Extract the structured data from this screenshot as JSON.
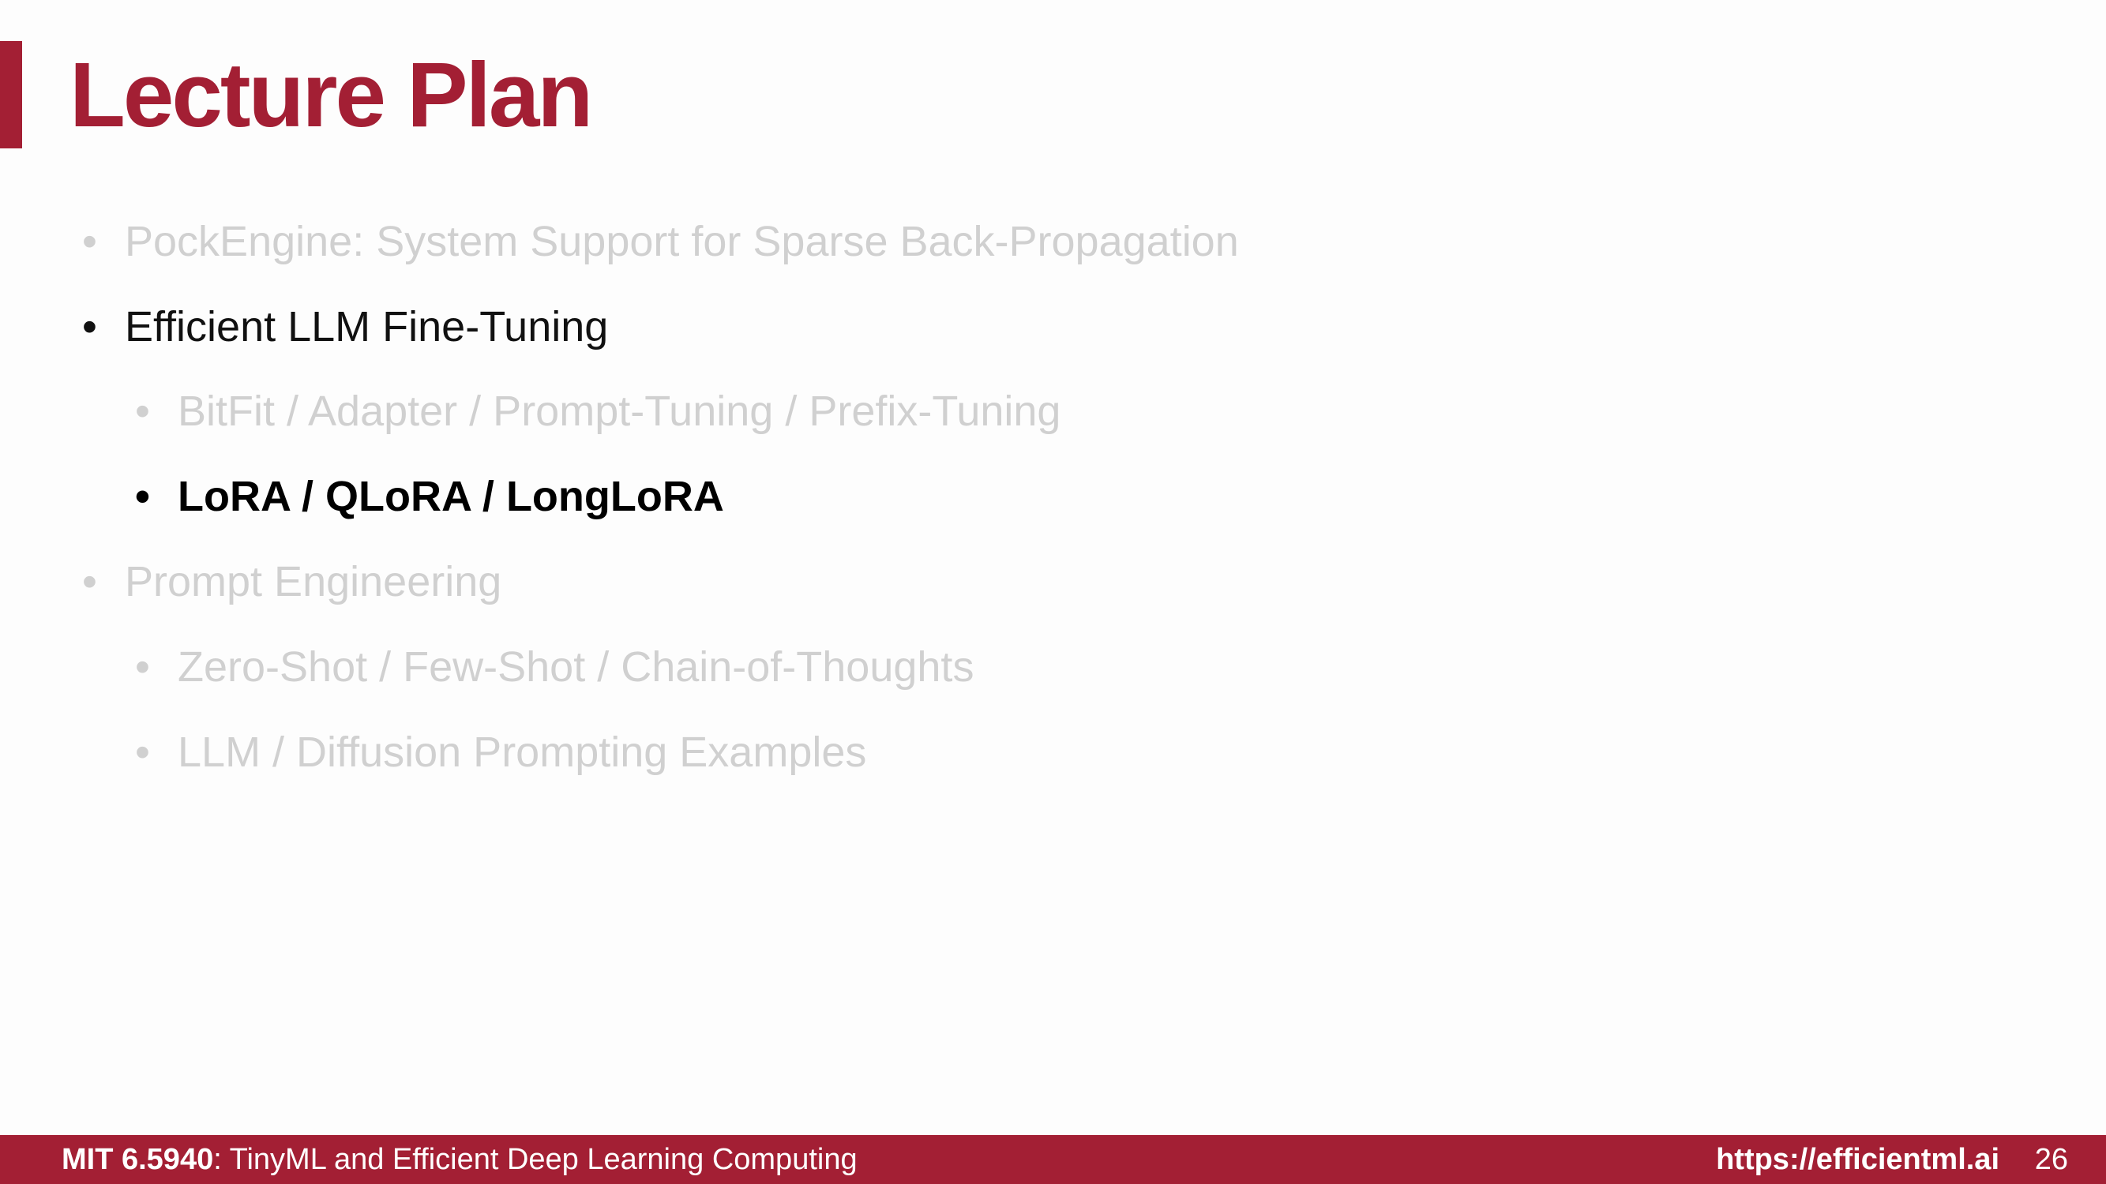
{
  "slide": {
    "title": "Lecture Plan",
    "accent_color": "#a31f34",
    "bullet_glyph": "•",
    "outline": [
      {
        "level": 1,
        "text": "PockEngine: System Support for Sparse Back-Propagation",
        "state": "dimmed"
      },
      {
        "level": 1,
        "text": "Efficient LLM Fine-Tuning",
        "state": "active"
      },
      {
        "level": 2,
        "text": "BitFit / Adapter / Prompt-Tuning / Prefix-Tuning",
        "state": "dimmed"
      },
      {
        "level": 2,
        "text": "LoRA / QLoRA / LongLoRA",
        "state": "current"
      },
      {
        "level": 1,
        "text": "Prompt Engineering",
        "state": "dimmed"
      },
      {
        "level": 2,
        "text": "Zero-Shot / Few-Shot / Chain-of-Thoughts",
        "state": "dimmed"
      },
      {
        "level": 2,
        "text": "LLM / Diffusion Prompting Examples",
        "state": "dimmed"
      }
    ]
  },
  "footer": {
    "course_code": "MIT 6.5940",
    "course_sep": ": ",
    "course_name": "TinyML and Efficient Deep Learning Computing",
    "url": "https://efficientml.ai",
    "page_number": "26"
  }
}
